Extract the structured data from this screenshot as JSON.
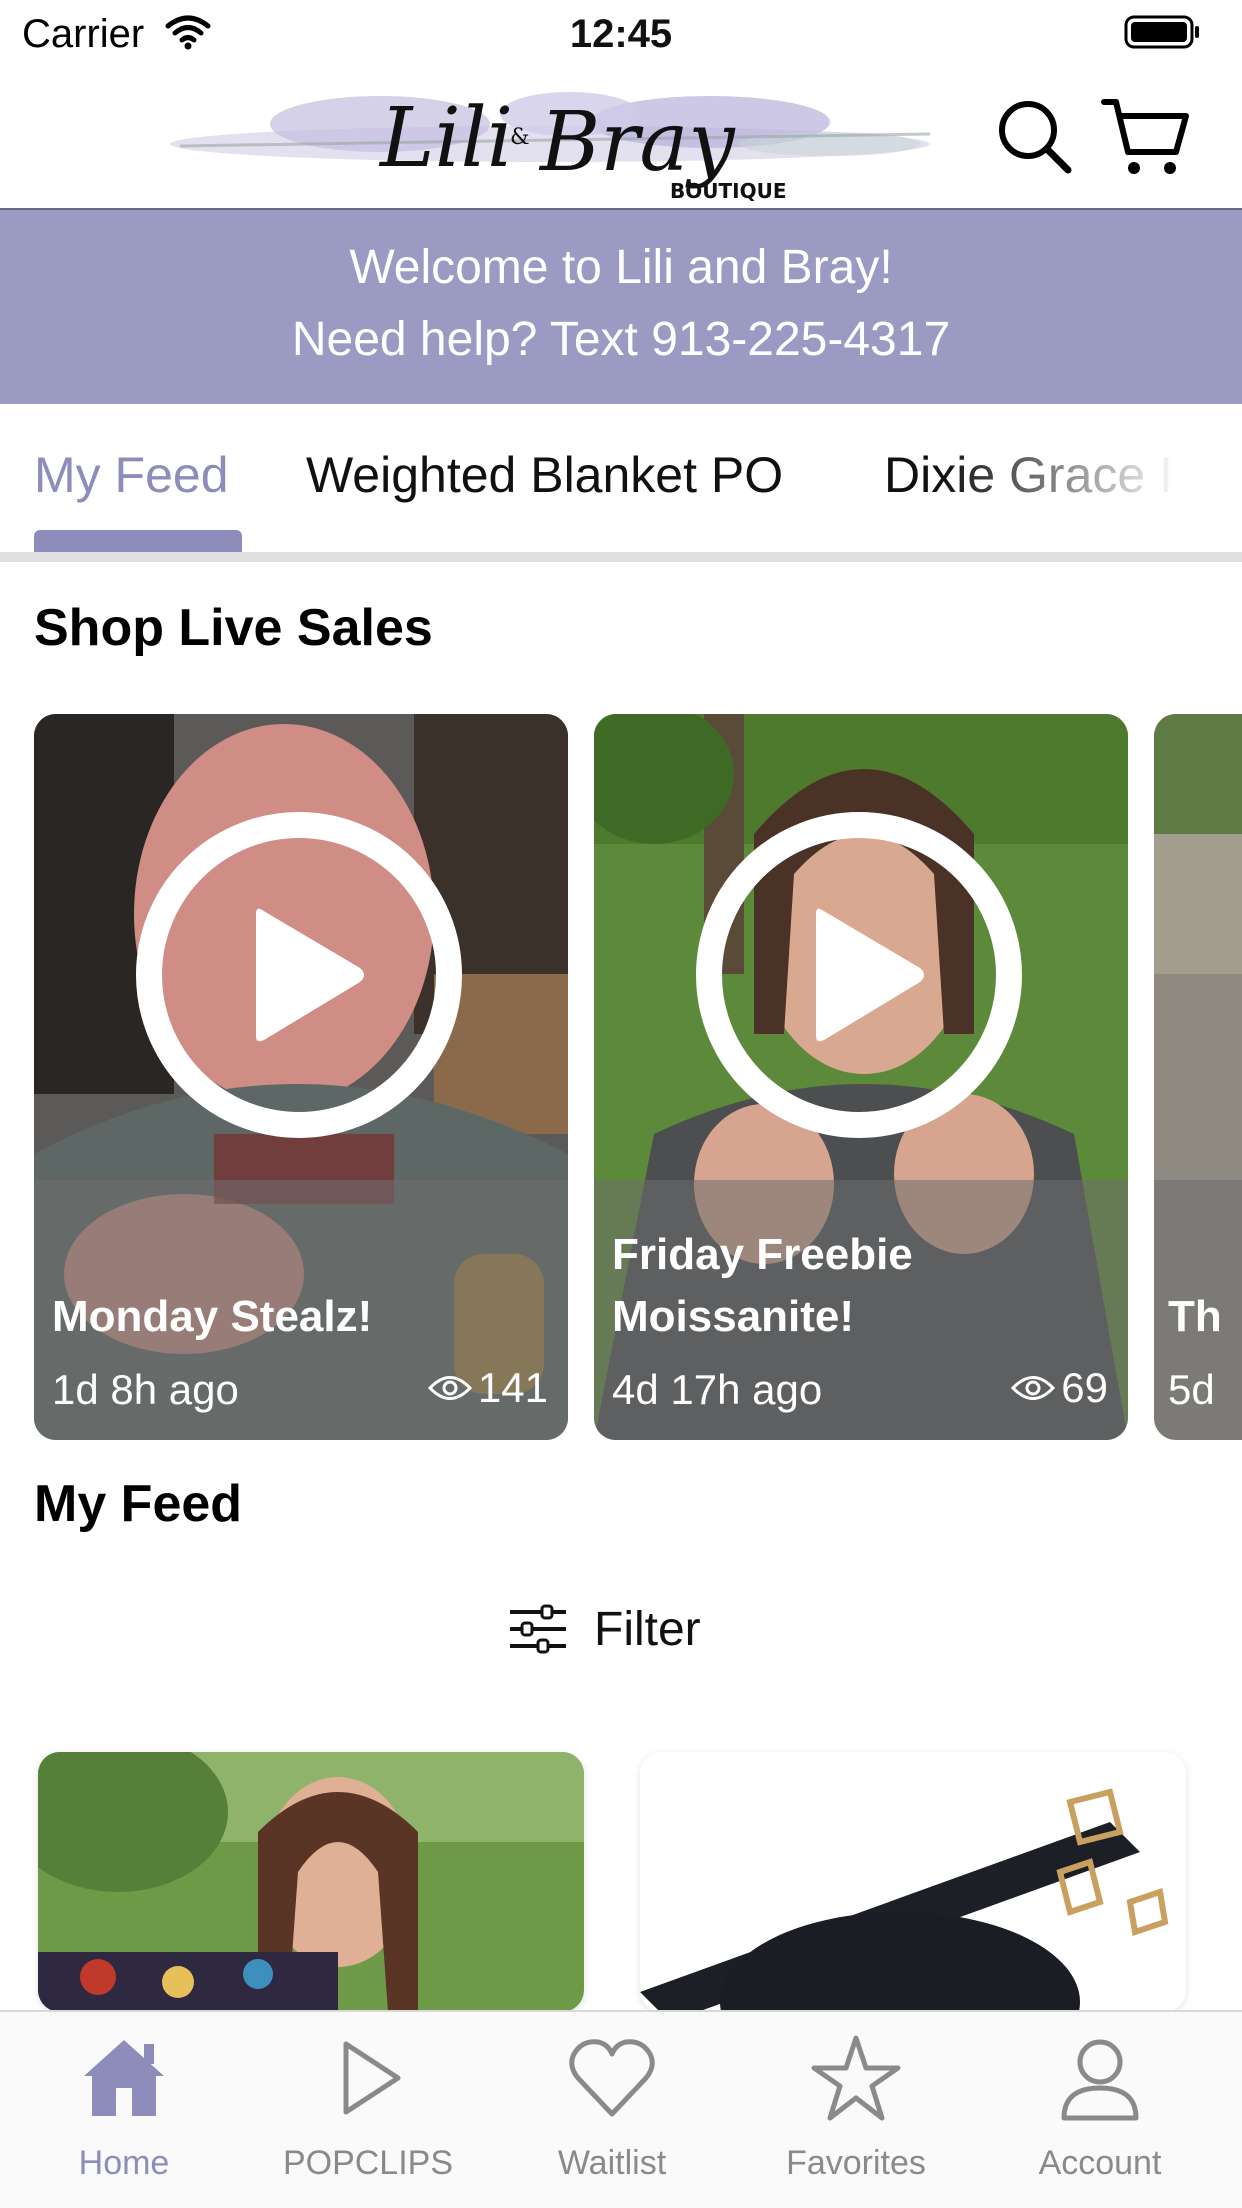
{
  "status_bar": {
    "carrier": "Carrier",
    "time": "12:45"
  },
  "header": {
    "brand_script": "Lili & Bray",
    "brand_sub": "BOUTIQUE",
    "search_icon": "search-icon",
    "cart_icon": "cart-icon"
  },
  "banner": {
    "line1": "Welcome to Lili and Bray!",
    "line2": "Need help? Text 913-225-4317",
    "color": "#9b9ac3"
  },
  "tabs": [
    {
      "label": "My Feed",
      "active": true
    },
    {
      "label": "Weighted Blanket PO",
      "active": false
    },
    {
      "label": "Dixie Grace I",
      "active": false
    }
  ],
  "accent_color": "#8e8cba",
  "live_sales": {
    "title": "Shop Live Sales",
    "cards": [
      {
        "title": "Monday Stealz!",
        "time": "1d 8h ago",
        "views": "141"
      },
      {
        "title": "Friday Freebie Moissanite!",
        "time": "4d 17h ago",
        "views": "69"
      },
      {
        "title": "Th",
        "time": "5d",
        "views": ""
      }
    ]
  },
  "feed": {
    "title": "My Feed",
    "filter_label": "Filter"
  },
  "bottom_nav": [
    {
      "label": "Home",
      "icon": "home-icon",
      "active": true
    },
    {
      "label": "POPCLIPS",
      "icon": "play-icon",
      "active": false
    },
    {
      "label": "Waitlist",
      "icon": "heart-icon",
      "active": false
    },
    {
      "label": "Favorites",
      "icon": "star-icon",
      "active": false
    },
    {
      "label": "Account",
      "icon": "person-icon",
      "active": false
    }
  ]
}
